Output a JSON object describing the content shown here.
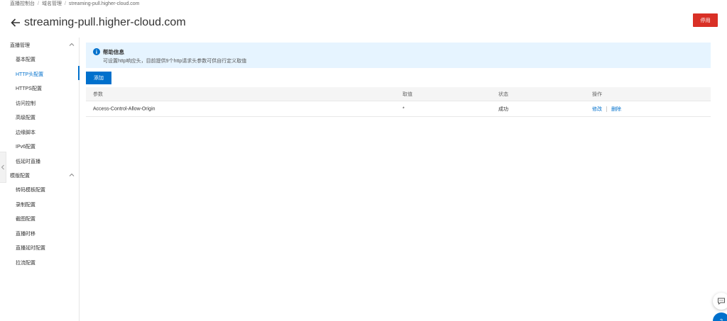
{
  "breadcrumb": [
    "直播控制台",
    "域名管理",
    "streaming-pull.higher-cloud.com"
  ],
  "page_title": "streaming-pull.higher-cloud.com",
  "disable_button": "停用",
  "sidebar": {
    "groups": [
      {
        "label": "直播管理",
        "items": [
          "基本配置",
          "HTTP头配置",
          "HTTPS配置",
          "访问控制",
          "高级配置",
          "边缘脚本",
          "IPv6配置",
          "低延时直播"
        ]
      },
      {
        "label": "模版配置",
        "items": [
          "转码模板配置",
          "录制配置",
          "截图配置",
          "直播时移",
          "直播延时配置",
          "拉流配置"
        ]
      }
    ],
    "active_item": "HTTP头配置"
  },
  "help": {
    "title": "帮助信息",
    "description": "可设置http响应头，目前提供9个http请求头参数可供自行定义取值"
  },
  "add_button": "添加",
  "table": {
    "headers": [
      "参数",
      "取值",
      "状态",
      "操作"
    ],
    "rows": [
      {
        "param": "Access-Control-Allow-Origin",
        "value": "*",
        "status": "成功",
        "actions": [
          "修改",
          "删除"
        ]
      }
    ]
  },
  "floating": {
    "help_label": "?"
  },
  "colors": {
    "primary": "#0070cc",
    "danger": "#d93026",
    "help_bg": "#e6f4ff"
  },
  "icons": [
    "back-arrow-icon",
    "chevron-up-icon",
    "info-icon",
    "chevron-left-icon",
    "chat-icon"
  ]
}
